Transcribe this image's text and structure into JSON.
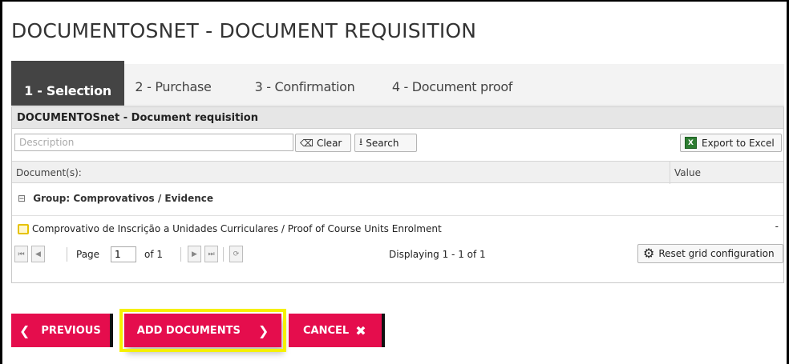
{
  "page": {
    "title": "DOCUMENTOSNET - DOCUMENT REQUISITION"
  },
  "tabs": [
    {
      "label": "1 - Selection",
      "active": true
    },
    {
      "label": "2 - Purchase"
    },
    {
      "label": "3 - Confirmation"
    },
    {
      "label": "4 - Document proof"
    }
  ],
  "grid": {
    "header": "DOCUMENTOSnet - Document requisition",
    "search": {
      "placeholder": "Description",
      "value": ""
    },
    "buttons": {
      "clear": "Clear",
      "search": "Search",
      "export": "Export to Excel",
      "reset": "Reset grid configuration"
    },
    "columns": {
      "document": "Document(s):",
      "value": "Value"
    },
    "group": "Group: Comprovativos / Evidence",
    "rows": [
      {
        "text": "Comprovativo de Inscrição a Unidades Curriculares / Proof of Course Units Enrolment",
        "value": "-"
      }
    ],
    "pager": {
      "page_label": "Page",
      "page_value": "1",
      "of_label": "of 1",
      "display": "Displaying 1 - 1 of 1"
    }
  },
  "actions": {
    "previous": "PREVIOUS",
    "add": "ADD DOCUMENTS",
    "cancel": "CANCEL"
  },
  "colors": {
    "accent": "#e50d4d",
    "highlight": "#f5f000",
    "tab_active": "#444444"
  }
}
